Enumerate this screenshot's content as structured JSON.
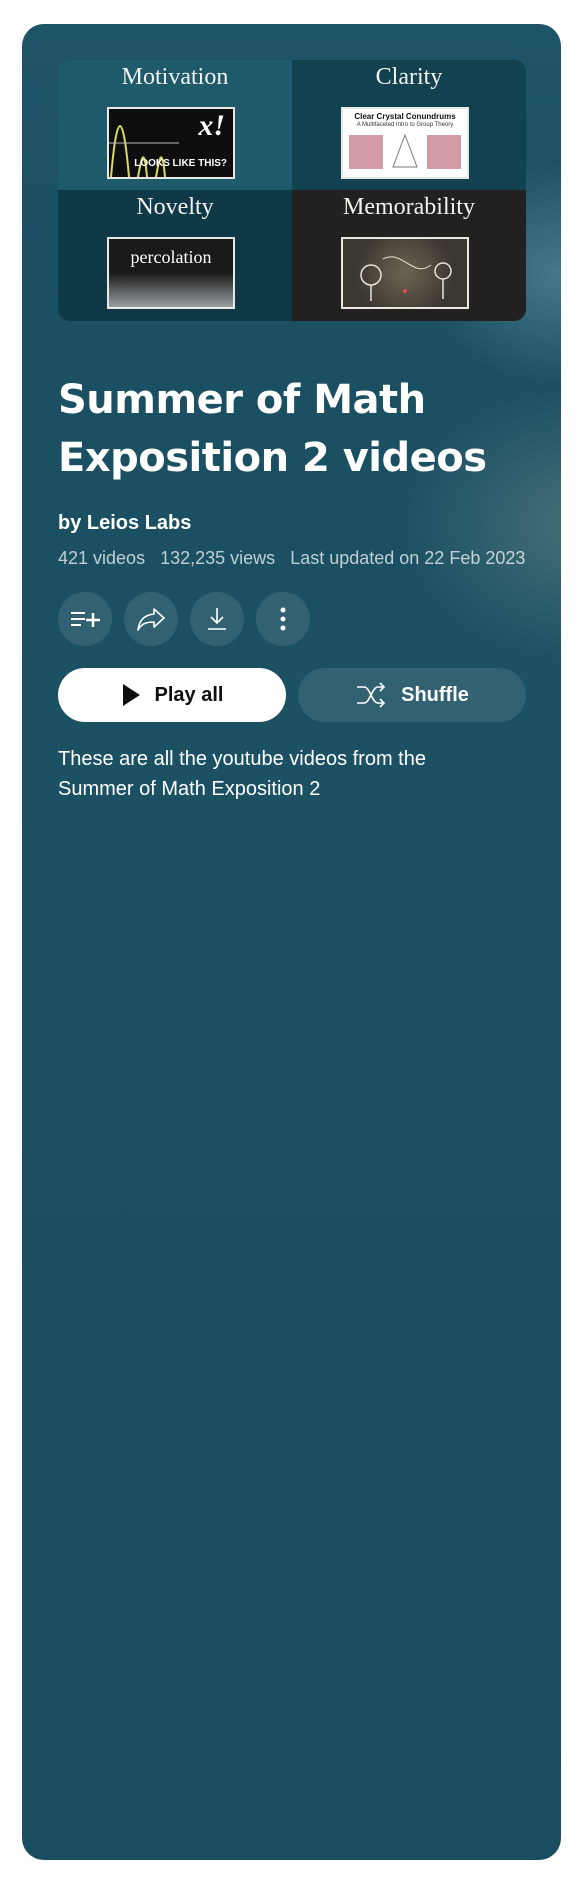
{
  "thumbnail": {
    "cells": [
      {
        "caption": "Motivation",
        "image_text": "x!",
        "image_subtext": "LOOKS LIKE THIS?"
      },
      {
        "caption": "Clarity",
        "image_text": "Clear Crystal Conundrums",
        "image_subtext": "A Multifaceted Intro to Group Theory"
      },
      {
        "caption": "Novelty",
        "image_text": "percolation"
      },
      {
        "caption": "Memorability"
      }
    ]
  },
  "playlist": {
    "title": "Summer of Math Exposition 2 videos",
    "owner": "by Leios Labs",
    "video_count": "421 videos",
    "views": "132,235 views",
    "last_updated": "Last updated on 22 Feb 2023",
    "description": "These are all the youtube videos from the Summer of Math Exposition 2"
  },
  "actions": {
    "icons": [
      "add-to-queue-icon",
      "share-icon",
      "download-icon",
      "more-vert-icon"
    ],
    "play_all_label": "Play all",
    "shuffle_label": "Shuffle"
  },
  "colors": {
    "card_background": "#1b4f62",
    "play_button": "#ffffff",
    "text": "#ffffff"
  }
}
